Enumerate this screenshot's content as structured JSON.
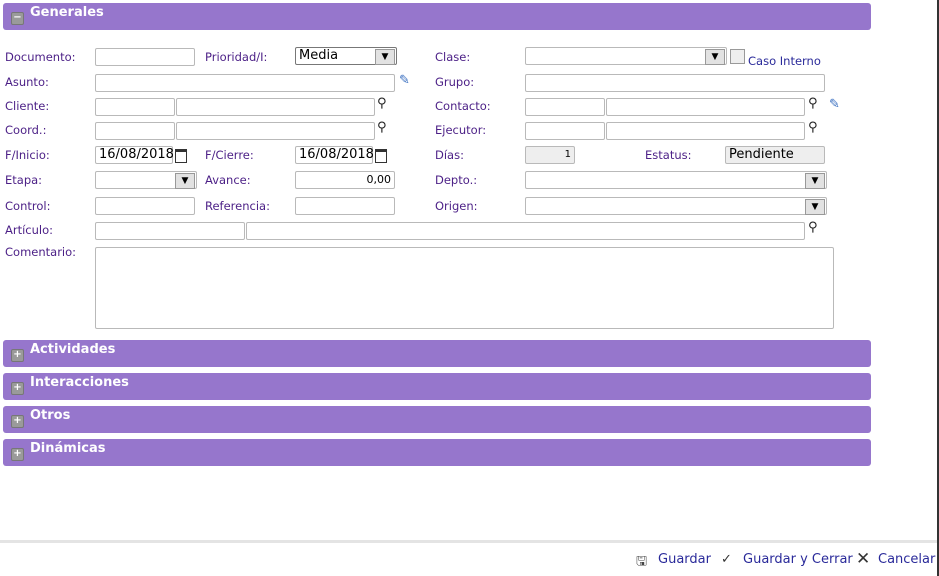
{
  "sections": {
    "generales": "Generales",
    "actividades": "Actividades",
    "interacciones": "Interacciones",
    "otros": "Otros",
    "dinamicas": "Dinámicas"
  },
  "labels": {
    "documento": "Documento:",
    "prioridad": "Prioridad/I:",
    "clase": "Clase:",
    "caso_interno": "Caso Interno",
    "asunto": "Asunto:",
    "grupo": "Grupo:",
    "cliente": "Cliente:",
    "contacto": "Contacto:",
    "coord": "Coord.:",
    "ejecutor": "Ejecutor:",
    "finicio": "F/Inicio:",
    "fcierre": "F/Cierre:",
    "dias": "Días:",
    "estatus": "Estatus:",
    "etapa": "Etapa:",
    "avance": "Avance:",
    "depto": "Depto.:",
    "control": "Control:",
    "referencia": "Referencia:",
    "origen": "Origen:",
    "articulo": "Artículo:",
    "comentario": "Comentario:"
  },
  "values": {
    "prioridad": "Media",
    "finicio": "16/08/2018",
    "fcierre": "16/08/2018",
    "dias": "1",
    "estatus": "Pendiente",
    "avance": "0,00"
  },
  "footer": {
    "guardar": "Guardar",
    "guardar_cerrar": "Guardar y Cerrar",
    "cancelar": "Cancelar"
  }
}
